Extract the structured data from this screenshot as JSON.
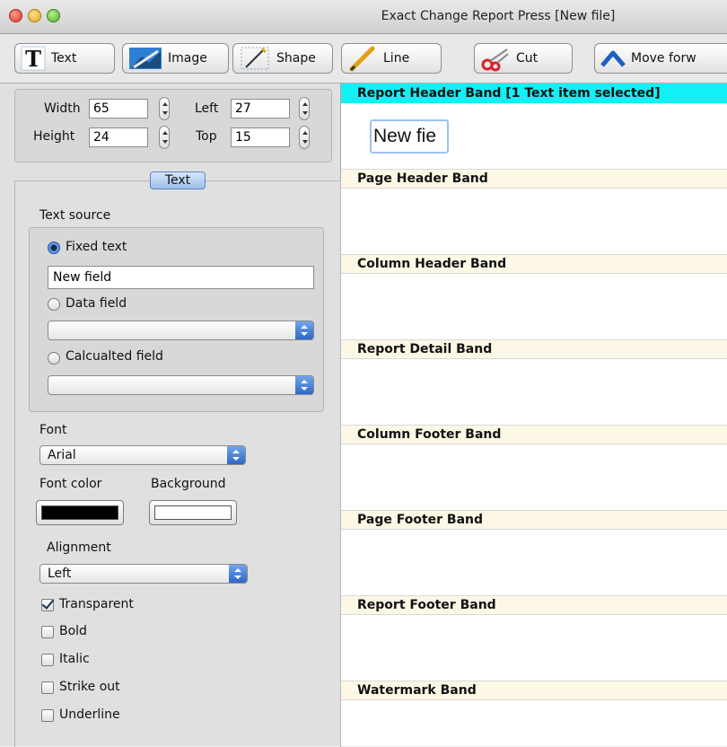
{
  "window": {
    "title": "Exact Change Report Press [New file]"
  },
  "toolbar": {
    "text": "Text",
    "image": "Image",
    "shape": "Shape",
    "line": "Line",
    "cut": "Cut",
    "move_forward": "Move forw"
  },
  "geometry": {
    "width_label": "Width",
    "width_value": "65",
    "height_label": "Height",
    "height_value": "24",
    "left_label": "Left",
    "left_value": "27",
    "top_label": "Top",
    "top_value": "15"
  },
  "inspector": {
    "tab": "Text",
    "text_source_label": "Text source",
    "fixed_text_label": "Fixed text",
    "fixed_text_value": "New field",
    "data_field_label": "Data field",
    "calculated_field_label": "Calcualted field",
    "font_label": "Font",
    "font_value": "Arial",
    "font_color_label": "Font color",
    "font_color": "#000000",
    "background_label": "Background",
    "background_color": "#ffffff",
    "alignment_label": "Alignment",
    "alignment_value": "Left",
    "transparent_label": "Transparent",
    "bold_label": "Bold",
    "italic_label": "Italic",
    "strike_label": "Strike out",
    "underline_label": "Underline"
  },
  "bands": [
    {
      "name": "Report Header Band [1 Text item selected]",
      "selected": true
    },
    {
      "name": "Page Header Band"
    },
    {
      "name": "Column Header Band"
    },
    {
      "name": "Report Detail Band"
    },
    {
      "name": "Column Footer Band"
    },
    {
      "name": "Page Footer Band"
    },
    {
      "name": "Report Footer Band"
    },
    {
      "name": "Watermark Band"
    }
  ],
  "canvas_field_text": "New fie"
}
